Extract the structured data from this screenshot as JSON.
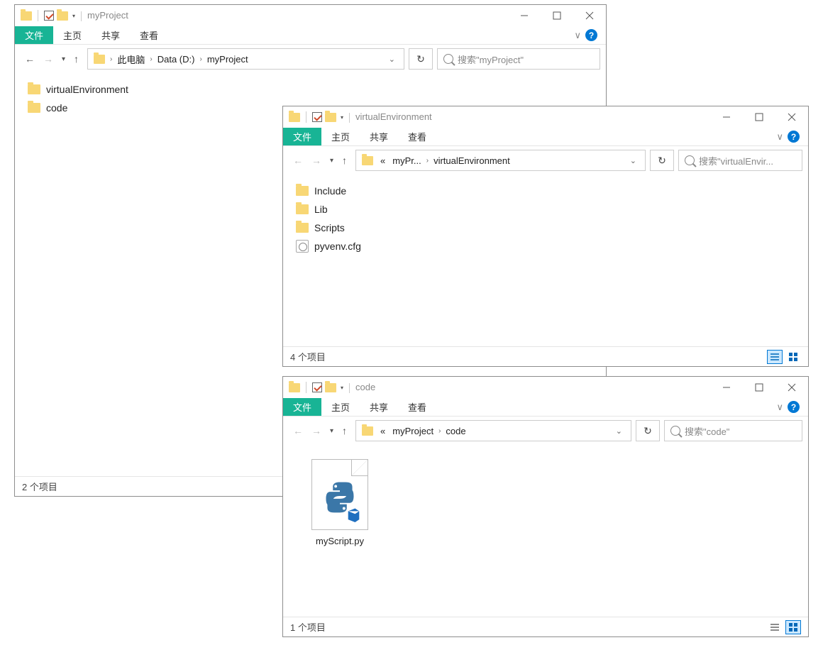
{
  "menu": {
    "file": "文件",
    "home": "主页",
    "share": "共享",
    "view": "查看"
  },
  "chevrons": {
    "expand": "∨"
  },
  "crumbs": {
    "this_pc": "此电脑",
    "data_d": "Data (D:)",
    "myproject": "myProject",
    "ellipsis_crumb": "myPr...",
    "ve": "virtualEnvironment",
    "code": "code"
  },
  "win1": {
    "title": "myProject",
    "search_placeholder": "搜索\"myProject\"",
    "items": [
      "virtualEnvironment",
      "code"
    ],
    "status": "2 个项目"
  },
  "win2": {
    "title": "virtualEnvironment",
    "search_placeholder": "搜索\"virtualEnvir...",
    "items_folders": [
      "Include",
      "Lib",
      "Scripts"
    ],
    "item_cfg": "pyvenv.cfg",
    "status": "4 个项目"
  },
  "win3": {
    "title": "code",
    "search_placeholder": "搜索\"code\"",
    "file_label": "myScript.py",
    "status": "1 个项目"
  }
}
